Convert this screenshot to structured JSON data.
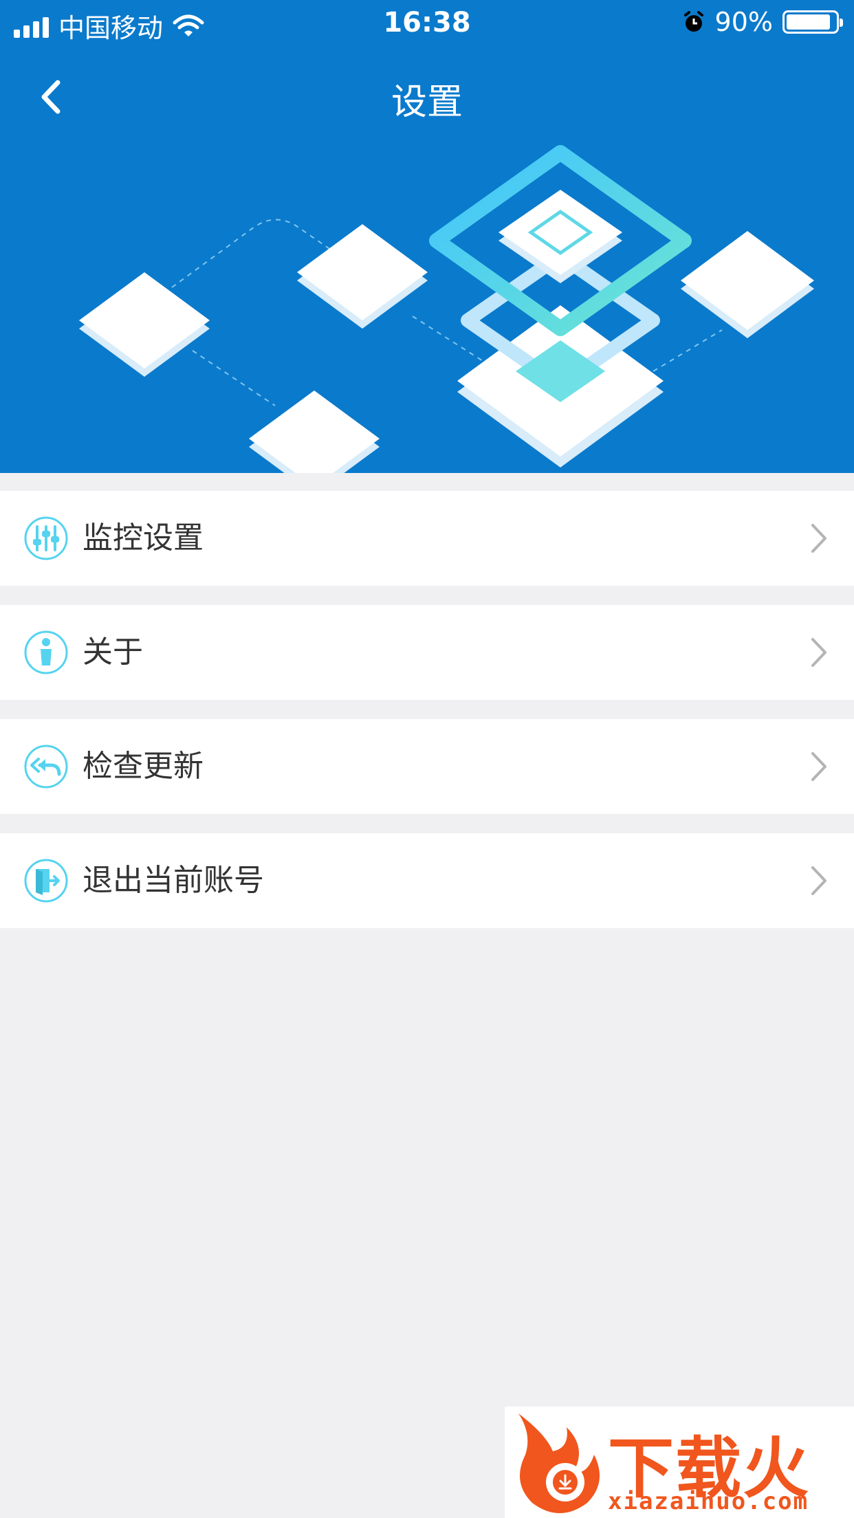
{
  "status_bar": {
    "carrier": "中国移动",
    "time": "16:38",
    "battery_percent": "90%",
    "battery_level": 0.9,
    "icons": [
      "signal-icon",
      "wifi-icon",
      "alarm-icon",
      "battery-icon"
    ]
  },
  "nav": {
    "title": "设置",
    "back_icon": "chevron-left-icon"
  },
  "menu": [
    {
      "label": "监控设置",
      "icon": "sliders-icon"
    },
    {
      "label": "关于",
      "icon": "person-icon"
    },
    {
      "label": "检查更新",
      "icon": "reply-all-icon"
    },
    {
      "label": "退出当前账号",
      "icon": "logout-icon"
    }
  ],
  "watermark": {
    "brand": "下载火",
    "url": "xiazaihuo.com"
  },
  "colors": {
    "header_bg": "#0a7acc",
    "page_bg": "#f0f0f2",
    "icon_cyan": "#55d3ef",
    "chevron": "#b4b4b4",
    "watermark": "#f0561d"
  }
}
